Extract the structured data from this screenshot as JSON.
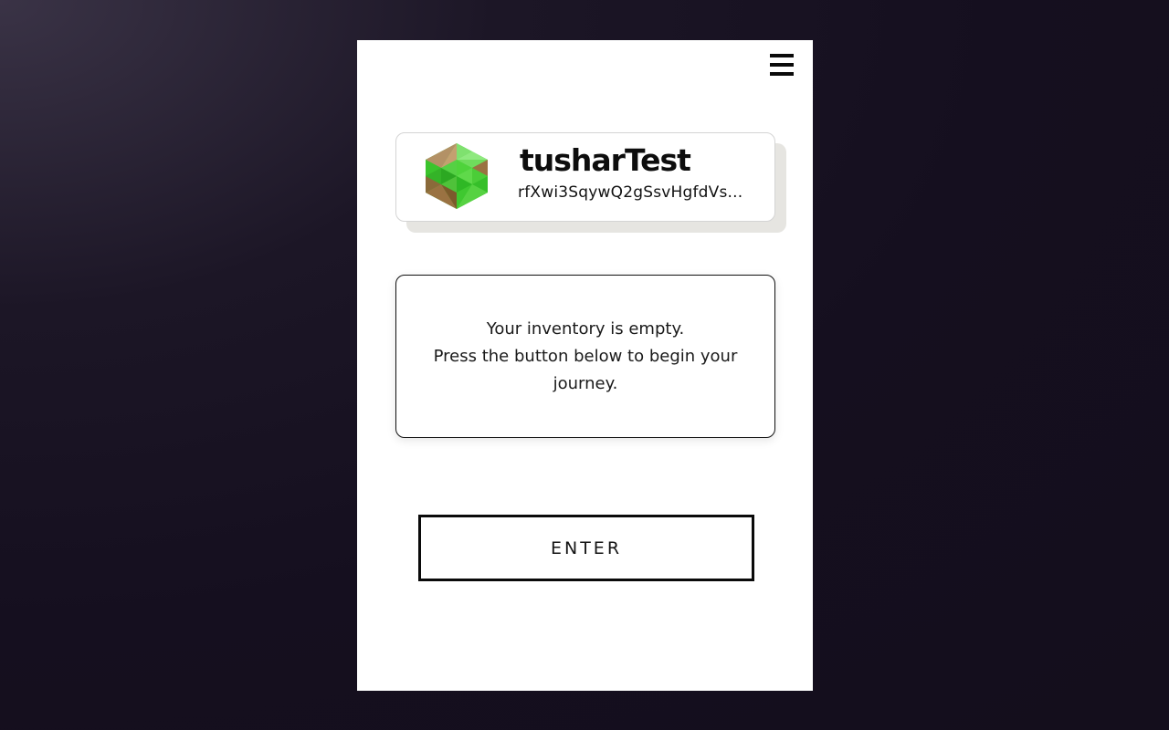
{
  "header": {
    "menu_icon": "hamburger-menu-icon"
  },
  "profile": {
    "username": "tusharTest",
    "address": "rfXwi3SqywQ2gSsvHgfdVs...",
    "avatar_icon": "isometric-grass-block-icon",
    "avatar_colors": {
      "grass_light": "#7fe16f",
      "grass_mid": "#4fd33b",
      "grass_dark": "#2fb825",
      "dirt_light": "#b39166",
      "dirt_mid": "#9a7242",
      "dirt_dark": "#7c5a2c"
    }
  },
  "inventory": {
    "line1": "Your inventory is empty.",
    "line2": "Press the button below to begin your journey."
  },
  "actions": {
    "enter_label": "ENTER"
  }
}
